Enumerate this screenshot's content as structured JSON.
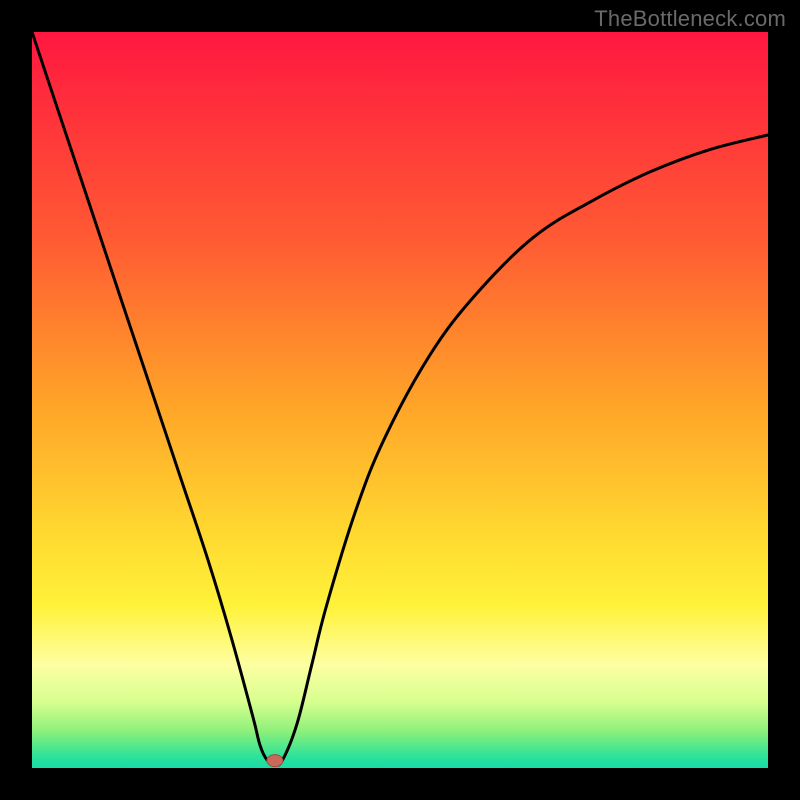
{
  "watermark": "TheBottleneck.com",
  "colors": {
    "frame": "#000000",
    "curve": "#000000",
    "marker_fill": "#c86a5a",
    "marker_stroke": "#a04a3d",
    "gradient_stops": [
      {
        "offset": 0.0,
        "color": "#ff1740"
      },
      {
        "offset": 0.28,
        "color": "#ff5a33"
      },
      {
        "offset": 0.5,
        "color": "#ffa228"
      },
      {
        "offset": 0.68,
        "color": "#ffd830"
      },
      {
        "offset": 0.78,
        "color": "#fff23a"
      },
      {
        "offset": 0.86,
        "color": "#fdffa2"
      },
      {
        "offset": 0.91,
        "color": "#d7ff8f"
      },
      {
        "offset": 0.95,
        "color": "#8df07a"
      },
      {
        "offset": 0.985,
        "color": "#2be29a"
      },
      {
        "offset": 1.0,
        "color": "#18dca6"
      }
    ]
  },
  "chart_data": {
    "type": "line",
    "title": "",
    "xlabel": "",
    "ylabel": "",
    "xlim": [
      0,
      100
    ],
    "ylim": [
      0,
      100
    ],
    "grid": false,
    "legend": false,
    "marker": {
      "x": 33,
      "y": 1
    },
    "series": [
      {
        "name": "bottleneck-curve",
        "x": [
          0,
          4,
          8,
          12,
          16,
          20,
          24,
          27,
          30,
          31,
          32,
          33,
          34,
          36,
          38,
          40,
          44,
          48,
          54,
          60,
          68,
          76,
          84,
          92,
          100
        ],
        "y": [
          100,
          88,
          76,
          64,
          52,
          40,
          28,
          18,
          7,
          3,
          1,
          0.5,
          1,
          6,
          14,
          22,
          35,
          45,
          56,
          64,
          72,
          77,
          81,
          84,
          86
        ]
      }
    ]
  }
}
